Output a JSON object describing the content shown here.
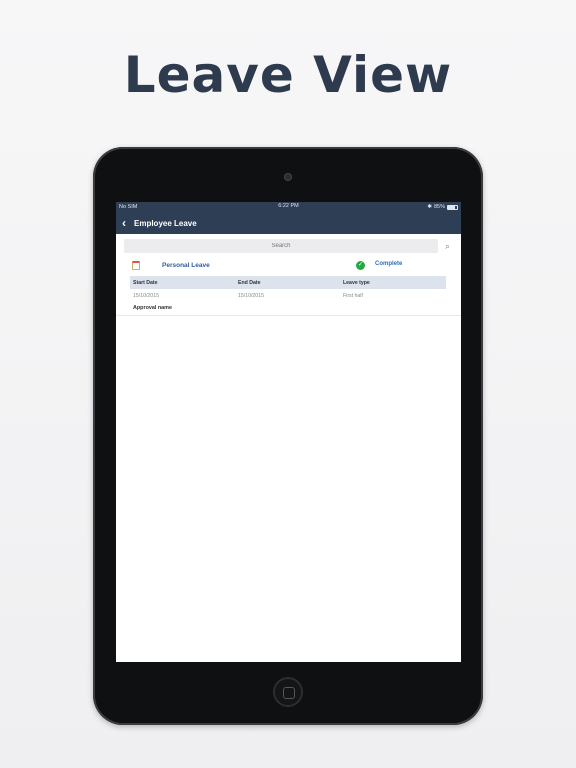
{
  "headline": "Leave View",
  "status_bar": {
    "carrier": "No SIM",
    "time": "6:22 PM",
    "battery": "85%"
  },
  "nav": {
    "title": "Employee Leave"
  },
  "search": {
    "placeholder": "Search"
  },
  "leave": {
    "type": "Personal Leave",
    "status": "Complete",
    "columns": [
      "Start Date",
      "End Date",
      "Leave type"
    ],
    "row": [
      "15/10/2015",
      "15/10/2015",
      "First half"
    ],
    "approval_label": "Approval name"
  },
  "colors": {
    "nav_bg": "#2e3e55",
    "accent": "#2e6fb8",
    "success": "#28a745"
  }
}
